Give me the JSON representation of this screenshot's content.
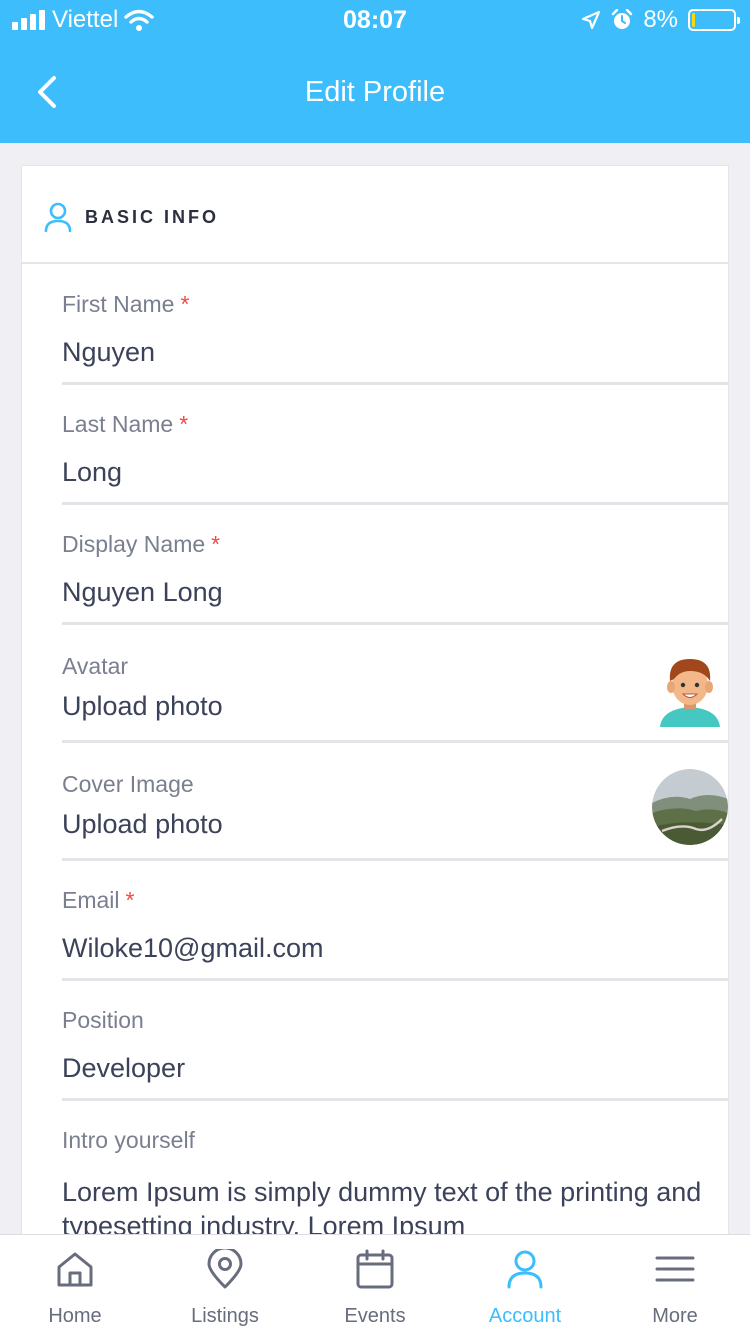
{
  "status_bar": {
    "carrier": "Viettel",
    "time": "08:07",
    "battery_percent": "8%",
    "battery_level": 0.08
  },
  "nav": {
    "title": "Edit Profile"
  },
  "section": {
    "title": "BASIC INFO"
  },
  "fields": {
    "first_name": {
      "label": "First Name",
      "required": "*",
      "value": "Nguyen"
    },
    "last_name": {
      "label": "Last Name",
      "required": "*",
      "value": "Long"
    },
    "display_name": {
      "label": "Display Name",
      "required": "*",
      "value": "Nguyen Long"
    },
    "avatar": {
      "label": "Avatar",
      "value": "Upload photo"
    },
    "cover_image": {
      "label": "Cover Image",
      "value": "Upload photo"
    },
    "email": {
      "label": "Email",
      "required": "*",
      "value": "Wiloke10@gmail.com"
    },
    "position": {
      "label": "Position",
      "value": "Developer"
    },
    "intro": {
      "label": "Intro yourself",
      "value": "Lorem Ipsum is simply dummy text of the printing and typesetting industry. Lorem Ipsum"
    }
  },
  "tabs": [
    {
      "label": "Home",
      "icon": "home-icon"
    },
    {
      "label": "Listings",
      "icon": "map-pin-icon"
    },
    {
      "label": "Events",
      "icon": "calendar-icon"
    },
    {
      "label": "Account",
      "icon": "user-icon"
    },
    {
      "label": "More",
      "icon": "menu-icon"
    }
  ],
  "active_tab": "Account",
  "colors": {
    "accent": "#3dbdfb",
    "required": "#f04949",
    "battery_low": "#ffd60a"
  }
}
